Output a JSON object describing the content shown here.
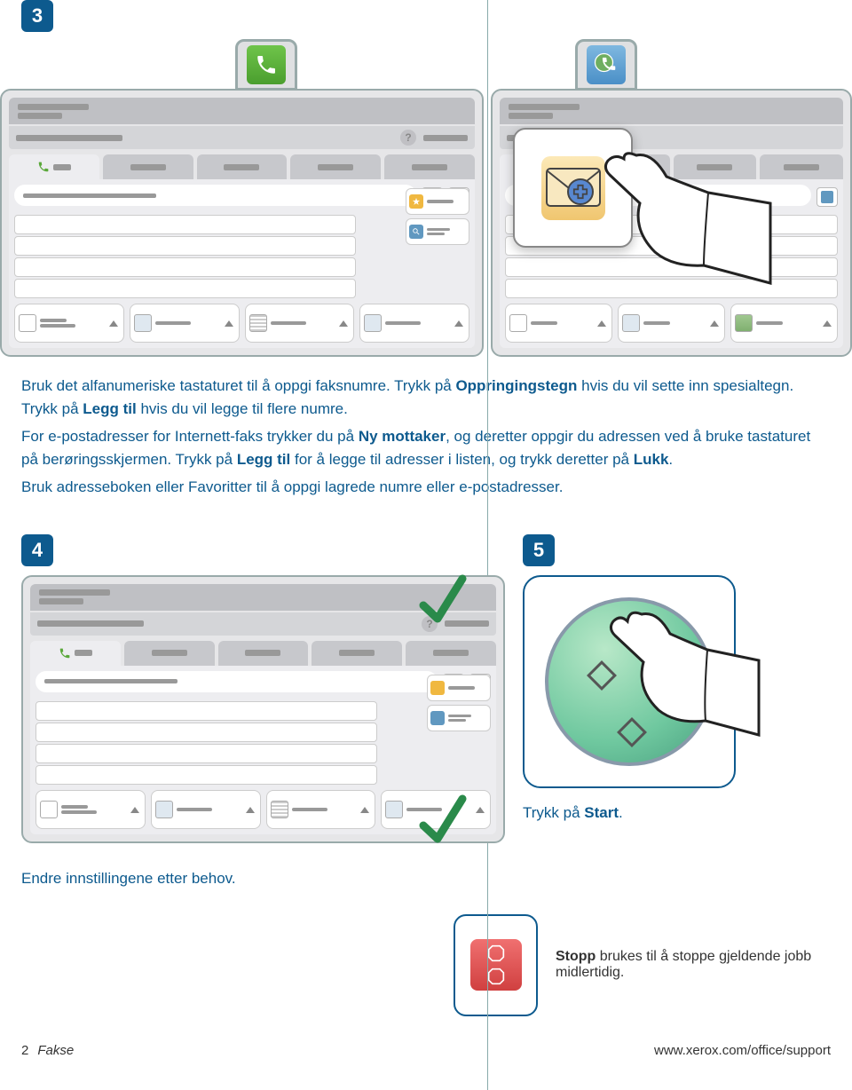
{
  "steps": {
    "s3": "3",
    "s4": "4",
    "s5": "5"
  },
  "body": {
    "p1a": "Bruk det alfanumeriske tastaturet til å oppgi faksnumre. Trykk på ",
    "p1b": "Oppringingstegn",
    "p1c": " hvis du vil sette inn spesialtegn. Trykk på ",
    "p1d": "Legg til",
    "p1e": " hvis du vil legge til flere numre.",
    "p2a": "For e-postadresser for Internett-faks trykker du på ",
    "p2b": "Ny mottaker",
    "p2c": ", og deretter oppgir du adressen ved å bruke tastaturet på berøringsskjermen. Trykk på ",
    "p2d": "Legg til",
    "p2e": " for å legge til adresser i listen, og trykk deretter på ",
    "p2f": "Lukk",
    "p2g": ".",
    "p3": "Bruk adresseboken eller Favoritter til å oppgi lagrede numre eller e-postadresser."
  },
  "step5": {
    "t1": "Trykk på ",
    "t2": "Start",
    "t3": "."
  },
  "caption4": "Endre innstillingene etter behov.",
  "stop": {
    "t1": "Stopp",
    "t2": " brukes til å stoppe gjeldende jobb midlertidig."
  },
  "footer": {
    "page": "2",
    "title": "Fakse",
    "url": "www.xerox.com/office/support"
  }
}
